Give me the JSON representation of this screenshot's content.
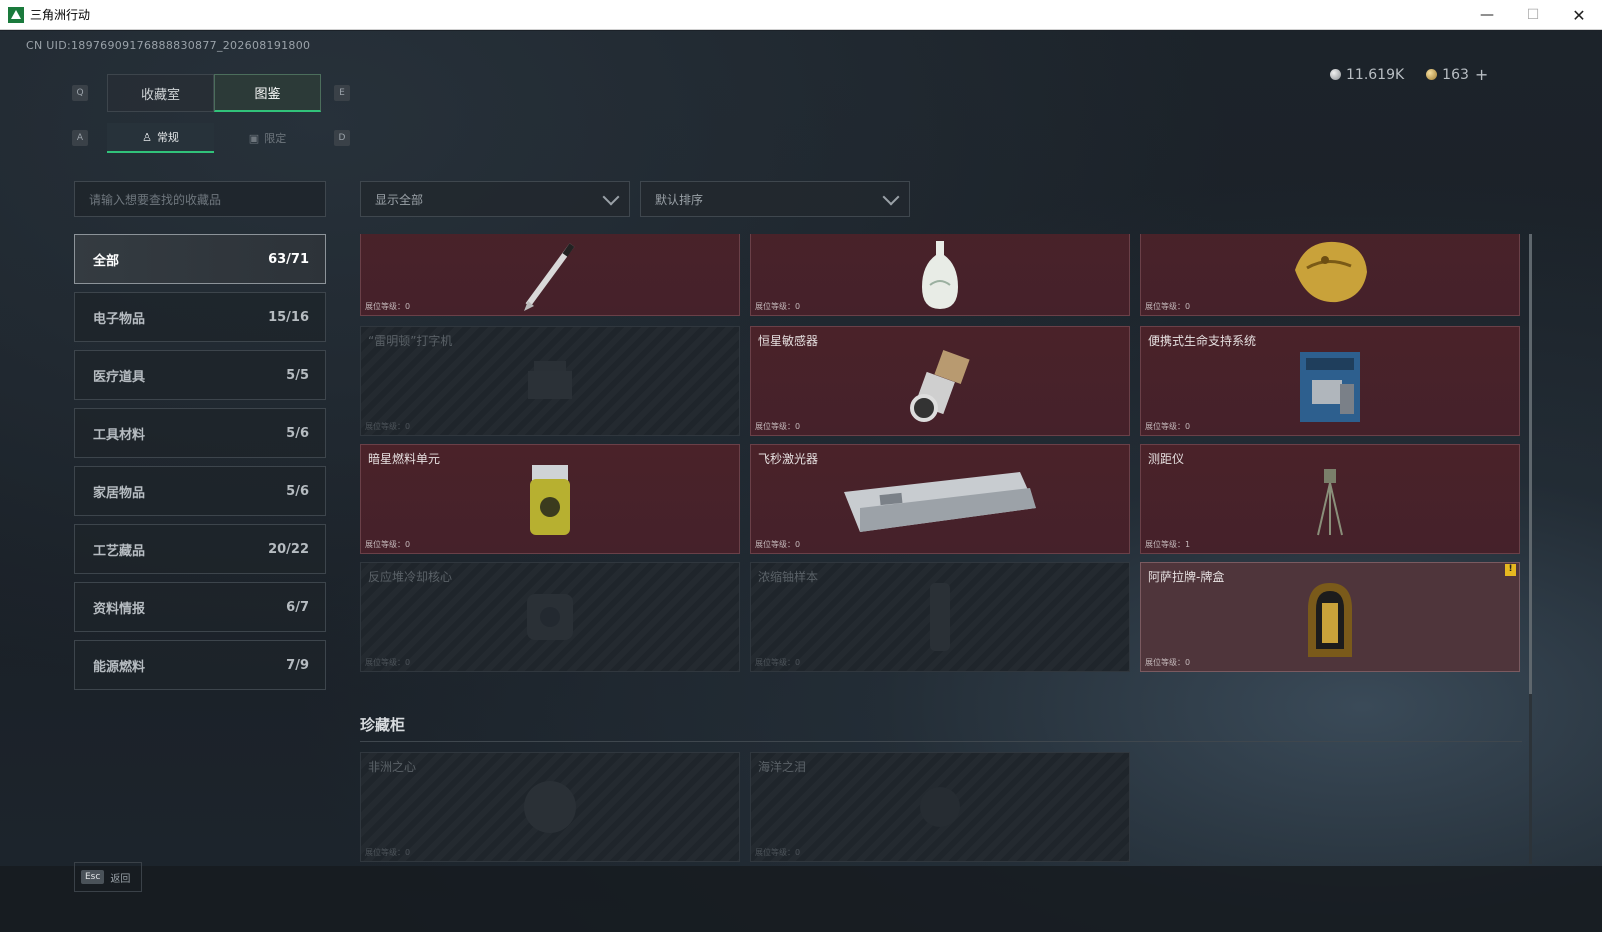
{
  "window": {
    "title": "三角洲行动",
    "min": "—",
    "max": "☐",
    "close": "✕"
  },
  "uid": "CN UID:18976909176888830877_202608191800",
  "currency": {
    "silver": "11.619K",
    "gold": "163",
    "plus": "+"
  },
  "hotkeys": {
    "q": "Q",
    "e": "E",
    "a": "A",
    "d": "D"
  },
  "tabs_main": [
    {
      "label": "收藏室"
    },
    {
      "label": "图鉴"
    }
  ],
  "tabs_sub": [
    {
      "label": "常规"
    },
    {
      "label": "限定"
    }
  ],
  "search": {
    "placeholder": "请输入想要查找的收藏品"
  },
  "filter": {
    "label": "显示全部"
  },
  "sort": {
    "label": "默认排序"
  },
  "categories": [
    {
      "label": "全部",
      "count": "63/71"
    },
    {
      "label": "电子物品",
      "count": "15/16"
    },
    {
      "label": "医疗道具",
      "count": "5/5"
    },
    {
      "label": "工具材料",
      "count": "5/6"
    },
    {
      "label": "家居物品",
      "count": "5/6"
    },
    {
      "label": "工艺藏品",
      "count": "20/22"
    },
    {
      "label": "资料情报",
      "count": "6/7"
    },
    {
      "label": "能源燃料",
      "count": "7/9"
    }
  ],
  "level_label": "展位等级：",
  "items": [
    {
      "name": "",
      "level": "0",
      "owned": true,
      "icon": "pen-icon"
    },
    {
      "name": "",
      "level": "0",
      "owned": true,
      "icon": "vase-icon"
    },
    {
      "name": "",
      "level": "0",
      "owned": true,
      "icon": "golden-statue-icon"
    },
    {
      "name": "“雷明顿”打字机",
      "level": "0",
      "owned": false,
      "icon": "typewriter-icon"
    },
    {
      "name": "恒星敏感器",
      "level": "0",
      "owned": true,
      "icon": "star-sensor-icon"
    },
    {
      "name": "便携式生命支持系统",
      "level": "0",
      "owned": true,
      "icon": "life-support-icon"
    },
    {
      "name": "暗星燃料单元",
      "level": "0",
      "owned": true,
      "icon": "fuel-cell-icon"
    },
    {
      "name": "飞秒激光器",
      "level": "0",
      "owned": true,
      "icon": "laser-icon"
    },
    {
      "name": "测距仪",
      "level": "1",
      "owned": true,
      "icon": "rangefinder-icon"
    },
    {
      "name": "反应堆冷却核心",
      "level": "0",
      "owned": false,
      "icon": "reactor-core-icon"
    },
    {
      "name": "浓缩铀样本",
      "level": "0",
      "owned": false,
      "icon": "uranium-icon"
    },
    {
      "name": "阿萨拉牌-牌盒",
      "level": "0",
      "owned": true,
      "icon": "card-box-icon",
      "badge": "!"
    }
  ],
  "showcase": {
    "title": "珍藏柜",
    "items": [
      {
        "name": "非洲之心",
        "level": "0",
        "owned": false,
        "icon": "diamond-icon"
      },
      {
        "name": "海洋之泪",
        "level": "0",
        "owned": false,
        "icon": "pearl-icon"
      }
    ]
  },
  "footer": {
    "esc_key": "Esc",
    "esc_label": "返回"
  }
}
